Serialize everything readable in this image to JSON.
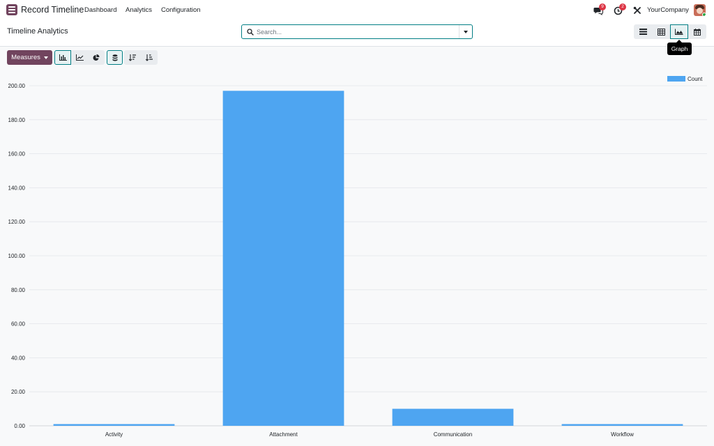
{
  "app": {
    "name": "Record Timeline",
    "menu": [
      "Dashboard",
      "Analytics",
      "Configuration"
    ]
  },
  "systray": {
    "messages_count": "9",
    "activities_count": "2",
    "company": "YourCompany"
  },
  "control_panel": {
    "title": "Timeline Analytics",
    "search_placeholder": "Search...",
    "views": [
      "list-view-icon",
      "pivot-view-icon",
      "graph-view-icon",
      "calendar-view-icon"
    ],
    "active_view": "graph",
    "tooltip": "Graph"
  },
  "toolbar": {
    "measures_label": "Measures"
  },
  "colors": {
    "brand": "#71445e",
    "accent": "#017e84",
    "bar": "#4ea5f1"
  },
  "chart_data": {
    "type": "bar",
    "categories": [
      "Activity",
      "Attachment",
      "Communication",
      "Workflow"
    ],
    "series": [
      {
        "name": "Count",
        "values": [
          1,
          197,
          10,
          1
        ]
      }
    ],
    "ylim": [
      0,
      200
    ],
    "yticks": [
      "0.00",
      "20.00",
      "40.00",
      "60.00",
      "80.00",
      "100.00",
      "120.00",
      "140.00",
      "160.00",
      "180.00",
      "200.00"
    ],
    "grid": true,
    "legend": "top-right"
  }
}
